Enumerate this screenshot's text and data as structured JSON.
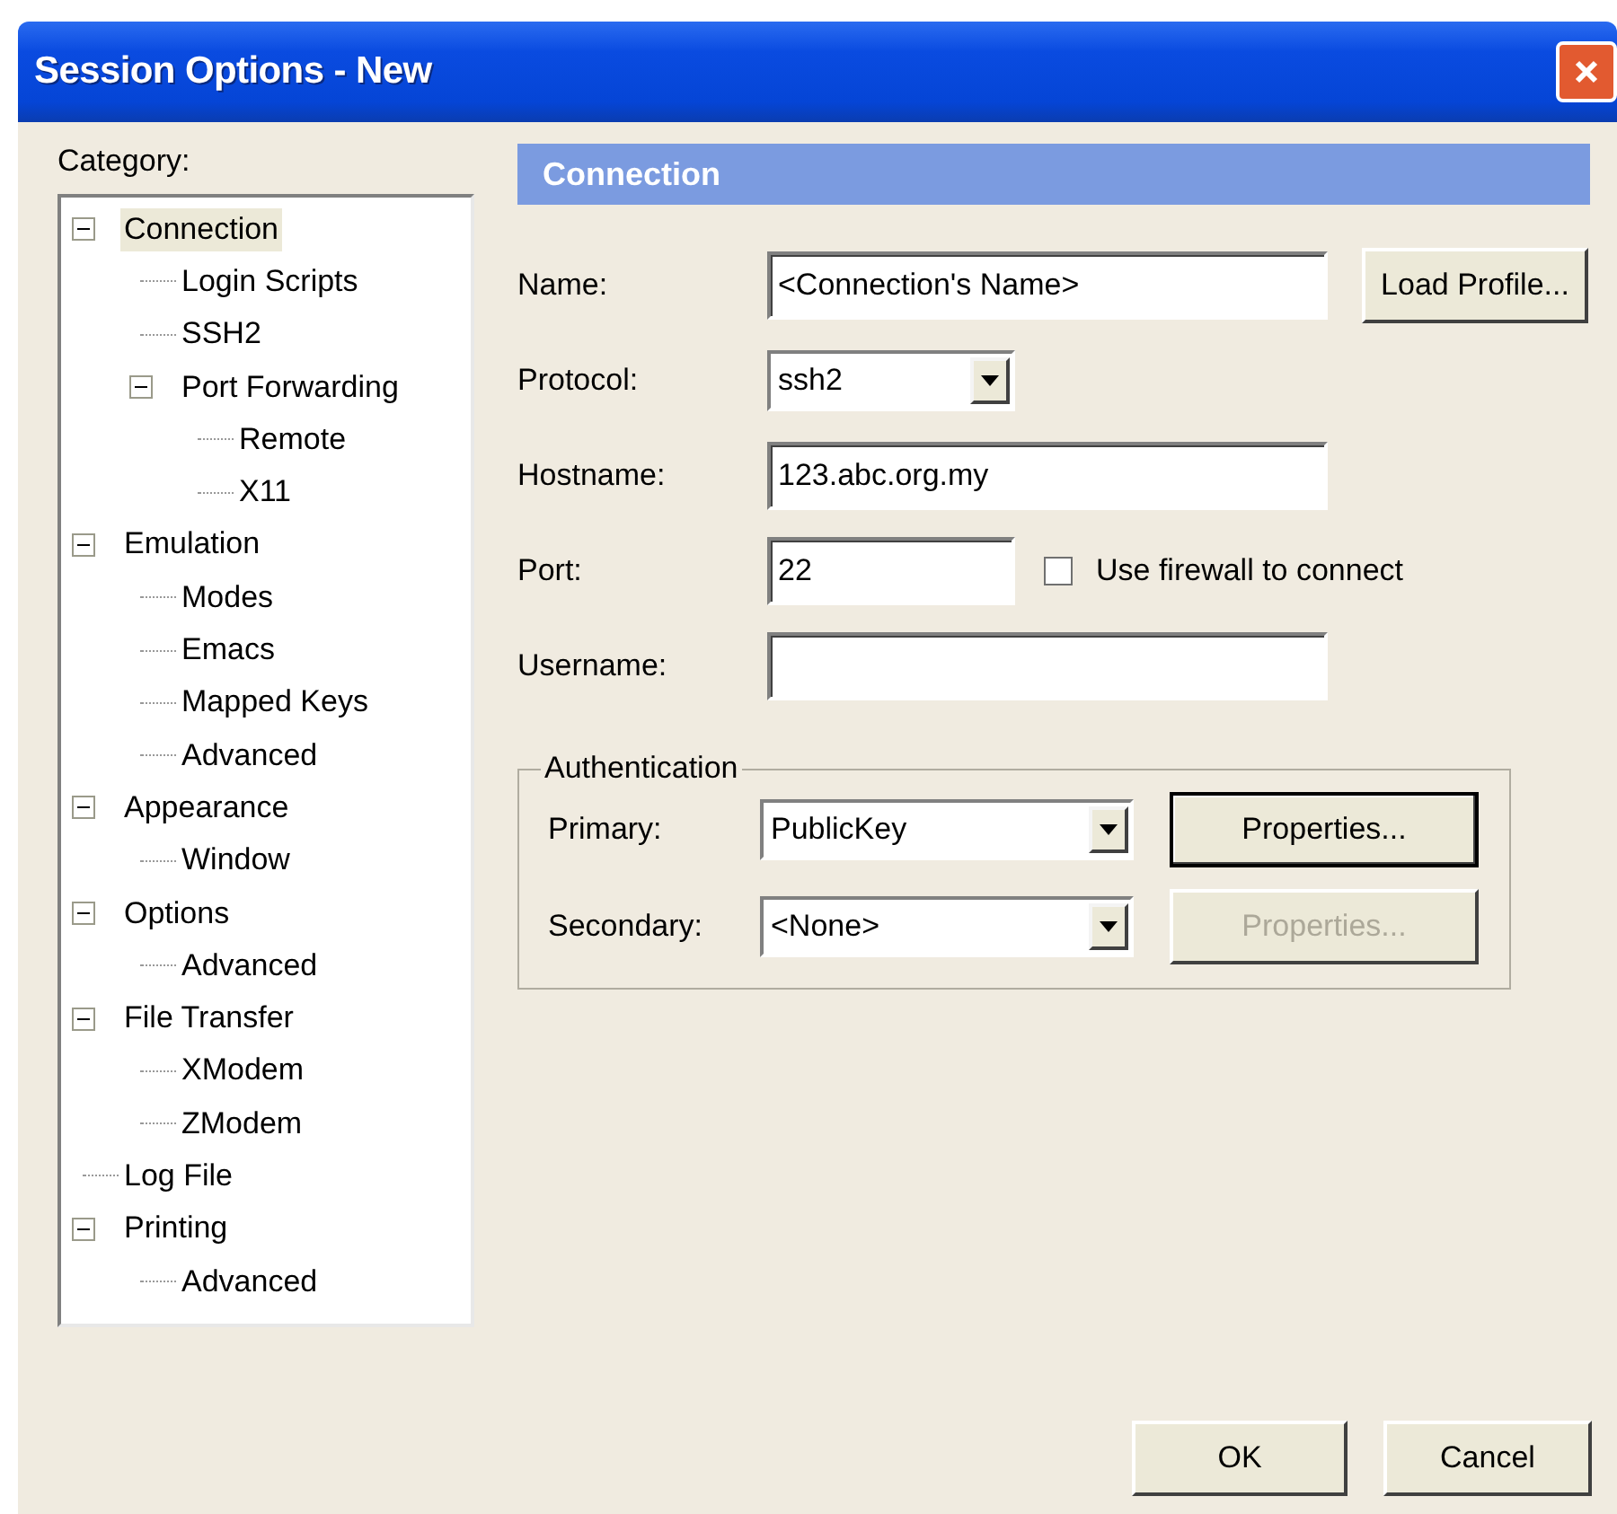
{
  "window": {
    "title": "Session Options - New"
  },
  "category": {
    "label": "Category:",
    "tree": [
      {
        "label": "Connection",
        "selected": true,
        "expanded": true,
        "children": [
          {
            "label": "Login Scripts",
            "selected": false
          },
          {
            "label": "SSH2",
            "selected": false
          },
          {
            "label": "Port Forwarding",
            "selected": false,
            "expanded": true,
            "children": [
              {
                "label": "Remote",
                "selected": false
              },
              {
                "label": "X11",
                "selected": false
              }
            ]
          }
        ]
      },
      {
        "label": "Emulation",
        "selected": false,
        "expanded": true,
        "children": [
          {
            "label": "Modes",
            "selected": false
          },
          {
            "label": "Emacs",
            "selected": false
          },
          {
            "label": "Mapped Keys",
            "selected": false
          },
          {
            "label": "Advanced",
            "selected": false
          }
        ]
      },
      {
        "label": "Appearance",
        "selected": false,
        "expanded": true,
        "children": [
          {
            "label": "Window",
            "selected": false
          }
        ]
      },
      {
        "label": "Options",
        "selected": false,
        "expanded": true,
        "children": [
          {
            "label": "Advanced",
            "selected": false
          }
        ]
      },
      {
        "label": "File Transfer",
        "selected": false,
        "expanded": true,
        "children": [
          {
            "label": "XModem",
            "selected": false
          },
          {
            "label": "ZModem",
            "selected": false
          }
        ]
      },
      {
        "label": "Log File",
        "selected": false
      },
      {
        "label": "Printing",
        "selected": false,
        "expanded": true,
        "children": [
          {
            "label": "Advanced",
            "selected": false
          }
        ]
      }
    ]
  },
  "panel": {
    "header": "Connection",
    "fields": [
      {
        "label": "Name:",
        "kind": "text",
        "value": "<Connection's Name>",
        "button": "Load Profile..."
      },
      {
        "label": "Protocol:",
        "kind": "select",
        "value": "ssh2"
      },
      {
        "label": "Hostname:",
        "kind": "text",
        "value": "123.abc.org.my"
      },
      {
        "label": "Port:",
        "kind": "short-text",
        "value": "22",
        "checkbox": {
          "label": "Use firewall to connect",
          "checked": false
        }
      },
      {
        "label": "Username:",
        "kind": "text"
      }
    ],
    "authentication": {
      "title": "Authentication",
      "rows": [
        {
          "label": "Primary:",
          "value": "PublicKey",
          "button": {
            "label": "Properties...",
            "disabled": false
          }
        },
        {
          "label": "Secondary:",
          "value": "<None>",
          "button": {
            "label": "Properties...",
            "disabled": true
          }
        }
      ]
    }
  },
  "buttons": [
    {
      "label": "OK"
    },
    {
      "label": "Cancel"
    }
  ]
}
